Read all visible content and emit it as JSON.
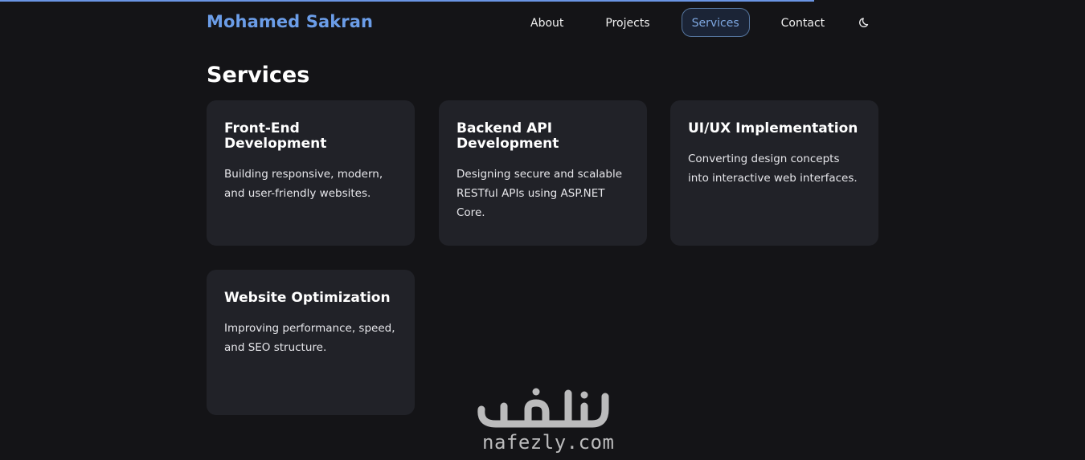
{
  "header": {
    "brand": "Mohamed Sakran",
    "nav": [
      {
        "label": "About"
      },
      {
        "label": "Projects"
      },
      {
        "label": "Services",
        "active": true
      },
      {
        "label": "Contact"
      }
    ],
    "theme_toggle_icon": "moon-icon",
    "brand_color": "#6b9de8",
    "accent_color": "#6a95e4",
    "scroll_progress_percent": 75
  },
  "services": {
    "title": "Services",
    "cards": [
      {
        "title": "Front-End Development",
        "description": "Building responsive, modern, and user-friendly websites."
      },
      {
        "title": "Backend API Development",
        "description": "Designing secure and scalable RESTful APIs using ASP.NET Core."
      },
      {
        "title": "UI/UX Implementation",
        "description": "Converting design concepts into interactive web interfaces."
      },
      {
        "title": "Website Optimization",
        "description": "Improving performance, speed, and SEO structure."
      }
    ]
  },
  "watermark": {
    "arabic": "نفذلي",
    "latin": "nafezly.com"
  }
}
